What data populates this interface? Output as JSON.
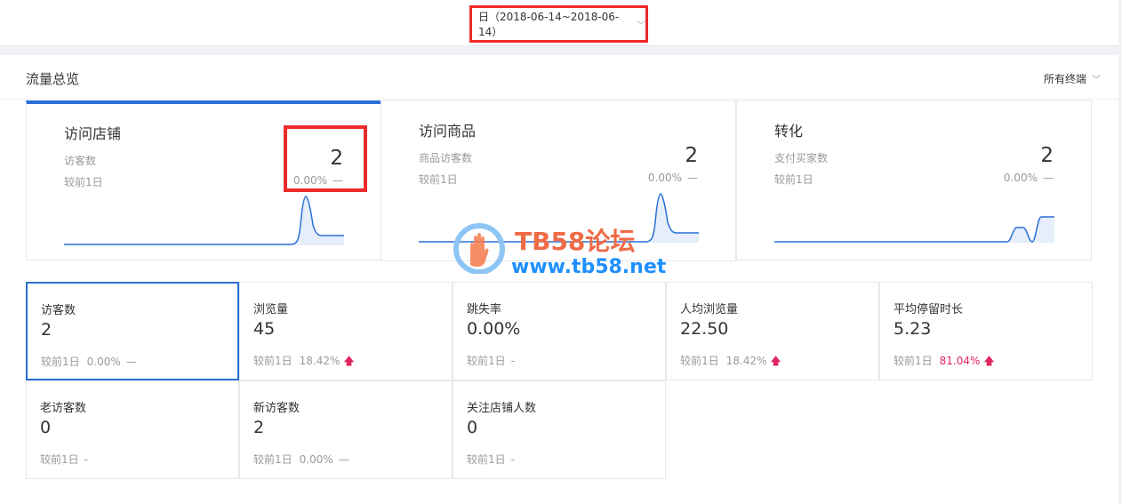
{
  "header": {
    "date_range": "日（2018-06-14~2018-06-14）"
  },
  "overview": {
    "title": "流量总览",
    "terminal": "所有终端"
  },
  "cards": [
    {
      "title": "访问店铺",
      "label": "访客数",
      "value": "2",
      "compare": "较前1日",
      "pct": "0.00%",
      "trend": "—"
    },
    {
      "title": "访问商品",
      "label": "商品访客数",
      "value": "2",
      "compare": "较前1日",
      "pct": "0.00%",
      "trend": "—"
    },
    {
      "title": "转化",
      "label": "支付买家数",
      "value": "2",
      "compare": "较前1日",
      "pct": "0.00%",
      "trend": "—"
    }
  ],
  "metrics": [
    {
      "label": "访客数",
      "value": "2",
      "compare": "较前1日",
      "pct": "0.00%",
      "trend": "—"
    },
    {
      "label": "浏览量",
      "value": "45",
      "compare": "较前1日",
      "pct": "18.42%",
      "trend": "up"
    },
    {
      "label": "跳失率",
      "value": "0.00%",
      "compare": "较前1日",
      "pct": "",
      "trend": "-"
    },
    {
      "label": "人均浏览量",
      "value": "22.50",
      "compare": "较前1日",
      "pct": "18.42%",
      "trend": "up"
    },
    {
      "label": "平均停留时长",
      "value": "5.23",
      "compare": "较前1日",
      "pct": "81.04%",
      "trend": "up"
    },
    {
      "label": "老访客数",
      "value": "0",
      "compare": "较前1日",
      "pct": "",
      "trend": "-"
    },
    {
      "label": "新访客数",
      "value": "2",
      "compare": "较前1日",
      "pct": "0.00%",
      "trend": "—"
    },
    {
      "label": "关注店铺人数",
      "value": "0",
      "compare": "较前1日",
      "pct": "",
      "trend": "-"
    }
  ],
  "watermark": {
    "title": "TB58论坛",
    "url": "www.tb58.net"
  },
  "colors": {
    "accent": "#2a6fd6",
    "up": "#e0245e",
    "highlight": "#ee2b2b"
  },
  "icons": {
    "dropdown": "chevron-down-icon",
    "trend_up": "arrow-up-icon"
  }
}
